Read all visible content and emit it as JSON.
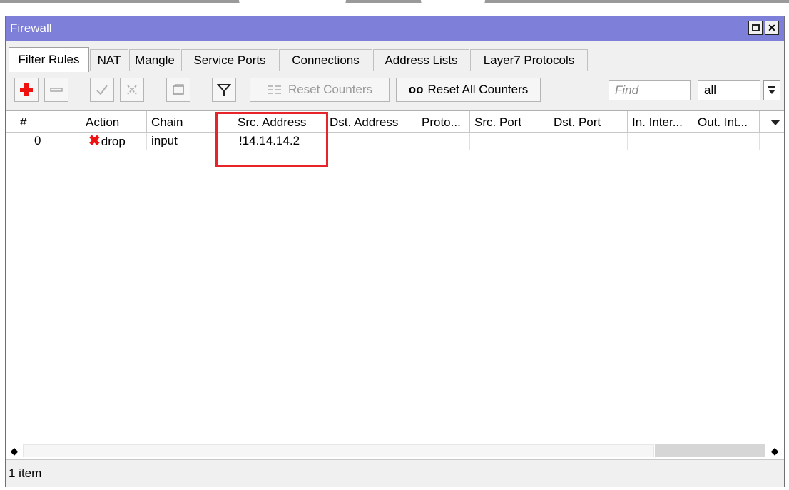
{
  "window": {
    "title": "Firewall"
  },
  "tabs": [
    "Filter Rules",
    "NAT",
    "Mangle",
    "Service Ports",
    "Connections",
    "Address Lists",
    "Layer7 Protocols"
  ],
  "toolbar": {
    "reset_counters": "Reset Counters",
    "reset_all_prefix": "oo",
    "reset_all_counters": "Reset All Counters",
    "find_placeholder": "Find",
    "filter_value": "all"
  },
  "table": {
    "columns": [
      "#",
      "",
      "Action",
      "Chain",
      "Src. Address",
      "Dst. Address",
      "Proto...",
      "Src. Port",
      "Dst. Port",
      "In. Inter...",
      "Out. Int...",
      ""
    ],
    "rows": [
      {
        "num": "0",
        "action": "drop",
        "chain": "input",
        "src_address": "!14.14.14.2"
      }
    ]
  },
  "status": {
    "text": "1 item"
  },
  "colors": {
    "titlebar": "#7e7fd9",
    "highlight": "#e8242b",
    "add_icon": "#e11"
  }
}
